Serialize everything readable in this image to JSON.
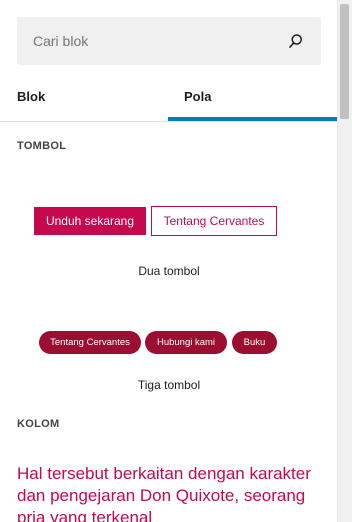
{
  "search": {
    "placeholder": "Cari blok"
  },
  "tabs": [
    {
      "label": "Blok",
      "active": false
    },
    {
      "label": "Pola",
      "active": true
    }
  ],
  "sections": {
    "tombol": "TOMBOL",
    "kolom": "KOLOM"
  },
  "patterns": {
    "dua_tombol": {
      "primary_label": "Unduh sekarang",
      "outline_label": "Tentang Cervantes",
      "title": "Dua tombol"
    },
    "tiga_tombol": {
      "buttons": [
        "Tentang Cervantes",
        "Hubungi kami",
        "Buku"
      ],
      "title": "Tiga tombol"
    },
    "kolom_text": "Hal tersebut berkaitan dengan karakter dan pengejaran Don Quixote, seorang pria yang terkenal"
  },
  "colors": {
    "accent": "#c6084f",
    "pill": "#9c0e31",
    "tab_indicator": "#007cba"
  }
}
